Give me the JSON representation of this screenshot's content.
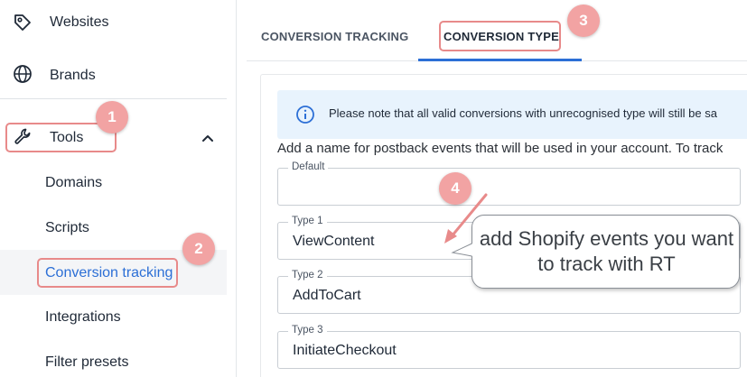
{
  "sidebar": {
    "items": [
      {
        "label": "Websites",
        "icon": "tag-icon"
      },
      {
        "label": "Brands",
        "icon": "globe-icon"
      },
      {
        "label": "Tools",
        "icon": "wrench-icon"
      }
    ],
    "sub_items": [
      {
        "label": "Domains"
      },
      {
        "label": "Scripts"
      },
      {
        "label": "Conversion tracking",
        "active": true
      },
      {
        "label": "Integrations"
      },
      {
        "label": "Filter presets"
      }
    ]
  },
  "tabs": [
    {
      "label": "CONVERSION TRACKING",
      "active": false
    },
    {
      "label": "CONVERSION TYPE",
      "active": true
    }
  ],
  "alert": {
    "icon": "info-icon",
    "text": "Please note that all valid conversions with unrecognised type will still be sa"
  },
  "helper_text": "Add a name for postback events that will be used in your account. To track",
  "fields": [
    {
      "label": "Default",
      "value": ""
    },
    {
      "label": "Type 1",
      "value": "ViewContent"
    },
    {
      "label": "Type 2",
      "value": "AddToCart"
    },
    {
      "label": "Type 3",
      "value": "InitiateCheckout"
    }
  ],
  "annotations": {
    "badges": [
      "1",
      "2",
      "3",
      "4"
    ],
    "callout": "add Shopify events you want to track with RT"
  },
  "colors": {
    "accent": "#2c6fd6",
    "active_link": "#2c6fd6",
    "annotation": "#e88a8a",
    "badge": "#f2a3a3",
    "alert_bg": "#e8f3fd"
  }
}
